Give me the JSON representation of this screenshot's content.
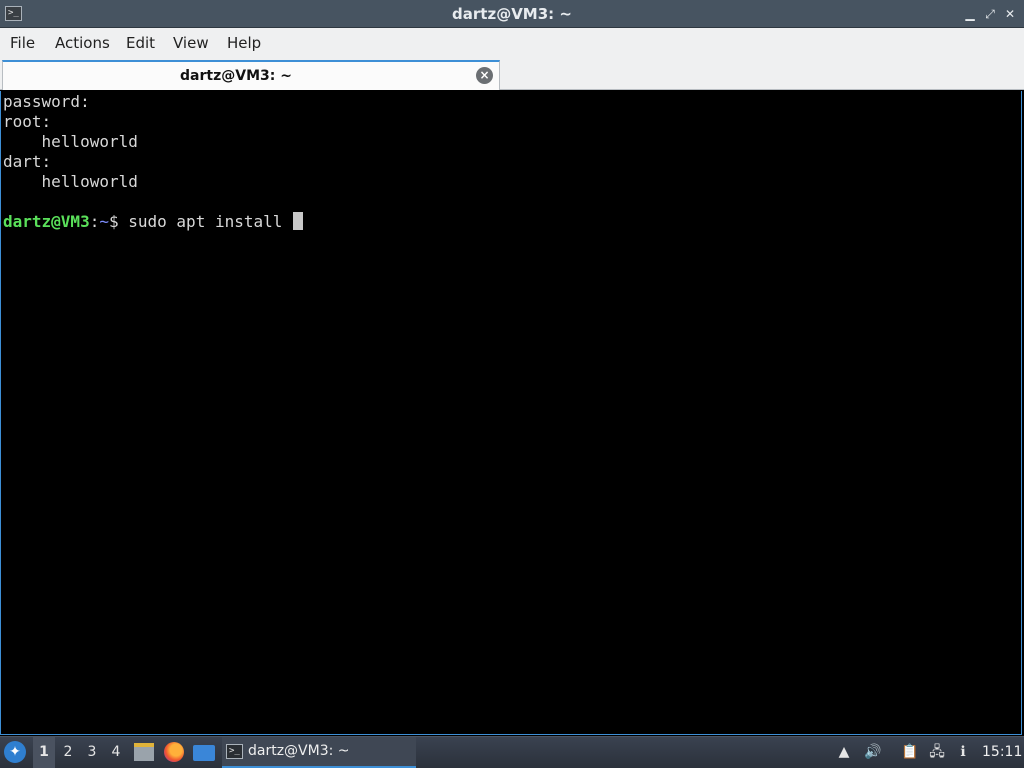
{
  "window": {
    "title": "dartz@VM3: ~",
    "icon": "terminal-icon",
    "controls": {
      "minimize": "▁",
      "restore": "⤢",
      "close": "✕"
    }
  },
  "menubar": {
    "items": [
      "File",
      "Actions",
      "Edit",
      "View",
      "Help"
    ]
  },
  "tabs": [
    {
      "label": "dartz@VM3: ~",
      "close_icon": "close-circle-icon"
    }
  ],
  "terminal": {
    "lines": [
      "password:",
      "root:",
      "    helloworld",
      "dart:",
      "    helloworld",
      ""
    ],
    "prompt": {
      "user_host": "dartz@VM3",
      "separator": ":",
      "path": "~",
      "symbol": "$",
      "command": " sudo apt install "
    },
    "colors": {
      "background": "#000000",
      "text": "#d8d8d8",
      "prompt_user": "#5ae05a",
      "prompt_path": "#7f8fff"
    }
  },
  "taskbar": {
    "workspaces": [
      "1",
      "2",
      "3",
      "4"
    ],
    "active_workspace": "1",
    "launchers": [
      "file-manager-icon",
      "firefox-icon",
      "show-desktop-icon"
    ],
    "task": {
      "label": "dartz@VM3: ~",
      "icon": "terminal-icon"
    },
    "tray": [
      "notification-icon",
      "volume-icon",
      "clipboard-icon",
      "network-icon",
      "update-icon"
    ],
    "clock": "15:11"
  }
}
